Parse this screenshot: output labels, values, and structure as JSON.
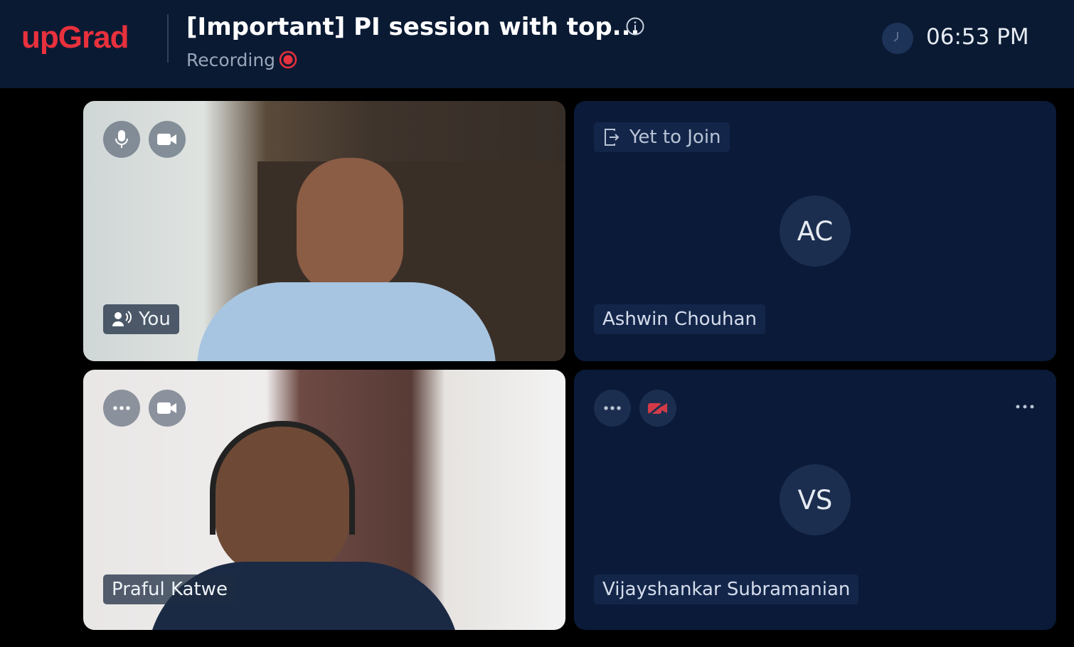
{
  "header": {
    "logo": "upGrad",
    "title": "[Important] PI session with top...",
    "recording_label": "Recording",
    "time": "06:53 PM"
  },
  "tiles": [
    {
      "name": "You"
    },
    {
      "name": "Ashwin Chouhan",
      "initials": "AC",
      "status": "Yet to Join"
    },
    {
      "name": "Praful Katwe"
    },
    {
      "name": "Vijayshankar Subramanian",
      "initials": "VS"
    }
  ],
  "icons": {
    "info": "info-icon",
    "recording": "recording-dot-icon",
    "clock": "clock-icon",
    "mic": "mic-icon",
    "camera": "camera-icon",
    "camera_off": "camera-off-icon",
    "more": "more-icon",
    "speaker": "speaker-icon",
    "join": "join-door-icon"
  },
  "colors": {
    "brand": "#e8313d",
    "header_bg": "#0a1a33",
    "tile_bg": "#0a1a38",
    "recording": "#e8313d",
    "camera_off": "#d23a48"
  }
}
